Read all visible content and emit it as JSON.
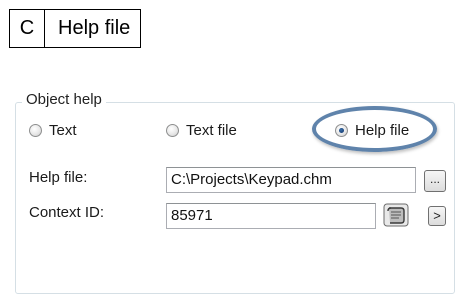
{
  "caption": {
    "letter": "C",
    "title": "Help file"
  },
  "object_help": {
    "legend": "Object help",
    "radios": [
      {
        "label": "Text",
        "checked": false
      },
      {
        "label": "Text file",
        "checked": false
      },
      {
        "label": "Help file",
        "checked": true
      }
    ],
    "help_file": {
      "label": "Help file:",
      "value": "C:\\Projects\\Keypad.chm",
      "browse_label": "..."
    },
    "context_id": {
      "label": "Context ID:",
      "value": "85971",
      "arrow_label": ">",
      "script_icon": "script-icon"
    }
  },
  "colors": {
    "highlight_ring": "#5f83ab",
    "group_border": "#d5dfe5",
    "field_border": "#abadb3"
  }
}
